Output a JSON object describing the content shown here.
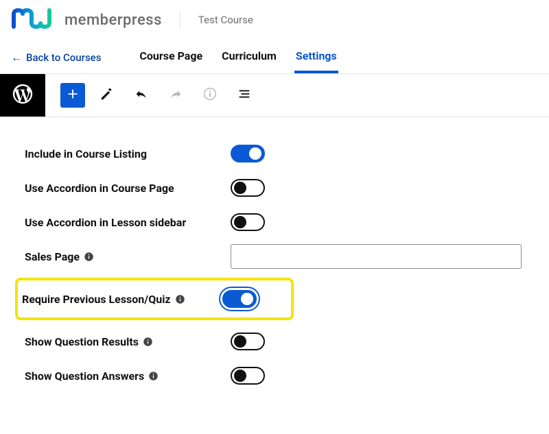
{
  "brand": {
    "name": "memberpress",
    "course": "Test Course"
  },
  "nav": {
    "back": "Back to Courses",
    "tabs": {
      "course_page": "Course Page",
      "curriculum": "Curriculum",
      "settings": "Settings"
    }
  },
  "settings": {
    "include_in_listing": {
      "label": "Include in Course Listing",
      "on": true
    },
    "accordion_course_page": {
      "label": "Use Accordion in Course Page",
      "on": false
    },
    "accordion_lesson_sidebar": {
      "label": "Use Accordion in Lesson sidebar",
      "on": false
    },
    "sales_page": {
      "label": "Sales Page",
      "value": ""
    },
    "require_prev": {
      "label": "Require Previous Lesson/Quiz",
      "on": true
    },
    "show_results": {
      "label": "Show Question Results",
      "on": false
    },
    "show_answers": {
      "label": "Show Question Answers",
      "on": false
    }
  },
  "colors": {
    "accent": "#0a5bd3",
    "highlight": "#f5e400"
  }
}
